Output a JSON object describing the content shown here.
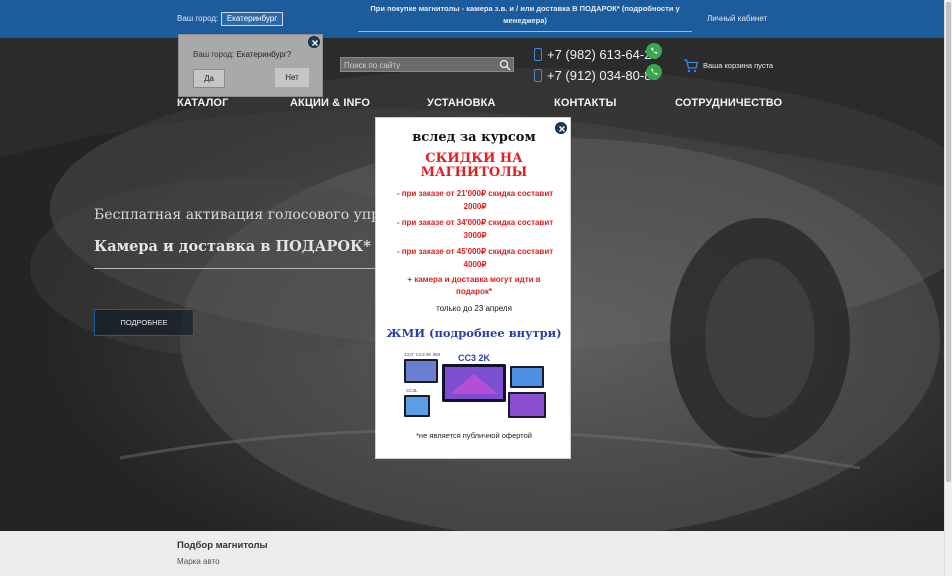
{
  "topbar": {
    "city_label": "Ваш город:",
    "city_value": "Екатеринбург",
    "promo_text": "При покупке магнитолы - камера з.в. и / или доставка В ПОДАРОК* (подробности у менеджера)",
    "cabinet_label": "Личный кабинет"
  },
  "search": {
    "placeholder": "Поиск по сайту"
  },
  "phones": [
    {
      "number": "+7 (982) 613-64-28"
    },
    {
      "number": "+7 (912) 034-80-88"
    }
  ],
  "cart": {
    "label": "Ваша корзина пуста"
  },
  "nav": [
    {
      "label": "КАТАЛОГ"
    },
    {
      "label": "АКЦИИ & INFO"
    },
    {
      "label": "УСТАНОВКА"
    },
    {
      "label": "КОНТАКТЫ"
    },
    {
      "label": "СОТРУДНИЧЕСТВО"
    }
  ],
  "hero": {
    "line1": "Бесплатная активация голосового управле",
    "line2": "Камера и доставка в ПОДАРОК*",
    "button_label": "ПОДРОБНЕЕ"
  },
  "city_popup": {
    "question_prefix": "Ваш город:",
    "question_city": "Екатеринбург?",
    "yes_label": "Да",
    "no_label": "Нет"
  },
  "modal": {
    "title": "вслед за курсом",
    "headline": "СКИДКИ НА МАГНИТОЛЫ",
    "tiers": [
      "- при заказе от 21'000₽ скидка составит 2000₽",
      "- при заказе от 34'000₽ скидка составит 3000₽",
      "- при заказе от 45'000₽ скидка составит 4000₽"
    ],
    "plus_note": "+ камера и доставка могут идти в подарок*",
    "deadline": "только до 23 апреля",
    "cta": "ЖМИ (подробнее внутри)",
    "image_labels": [
      "13,0\" CC3 2K 360",
      "CC3 2K",
      "CC3L"
    ],
    "footnote": "*не является публичной офертой"
  },
  "bottom": {
    "title": "Подбор магнитолы",
    "subtitle": "Марка авто"
  },
  "colors": {
    "topbar": "#1d5c9c",
    "promo_red": "#e0201e",
    "cta_blue": "#2b3fa8",
    "whatsapp_green": "#3aa650"
  }
}
